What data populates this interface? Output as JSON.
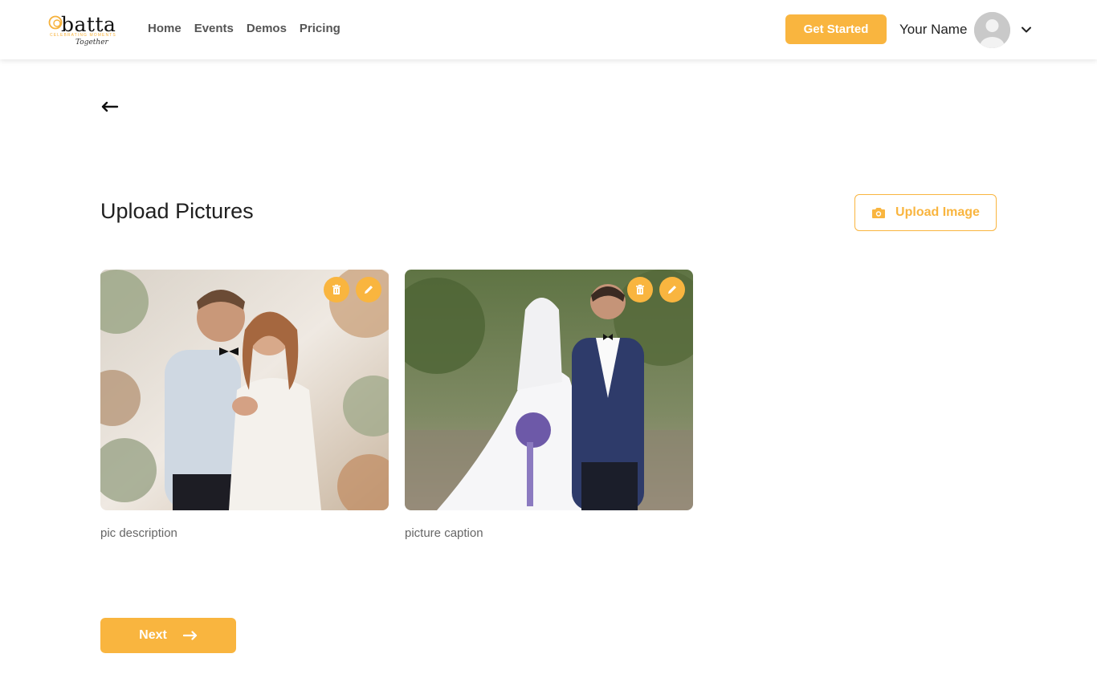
{
  "header": {
    "logo": {
      "wordmark": "batta",
      "tagline": "CELEBRATING MOMENTS",
      "script": "Together"
    },
    "nav": [
      {
        "label": "Home"
      },
      {
        "label": "Events"
      },
      {
        "label": "Demos"
      },
      {
        "label": "Pricing"
      }
    ],
    "cta_label": "Get Started",
    "user_name": "Your Name"
  },
  "page": {
    "title": "Upload Pictures",
    "upload_label": "Upload Image",
    "next_label": "Next"
  },
  "pictures": [
    {
      "caption": "pic description"
    },
    {
      "caption": "picture caption"
    }
  ],
  "colors": {
    "accent": "#f9b53f",
    "text": "#222222",
    "muted": "#666666"
  },
  "icons": {
    "back": "arrow-left-icon",
    "camera": "camera-icon",
    "delete": "trash-icon",
    "edit": "pencil-icon",
    "chevron": "chevron-down-icon",
    "next": "arrow-right-icon"
  }
}
